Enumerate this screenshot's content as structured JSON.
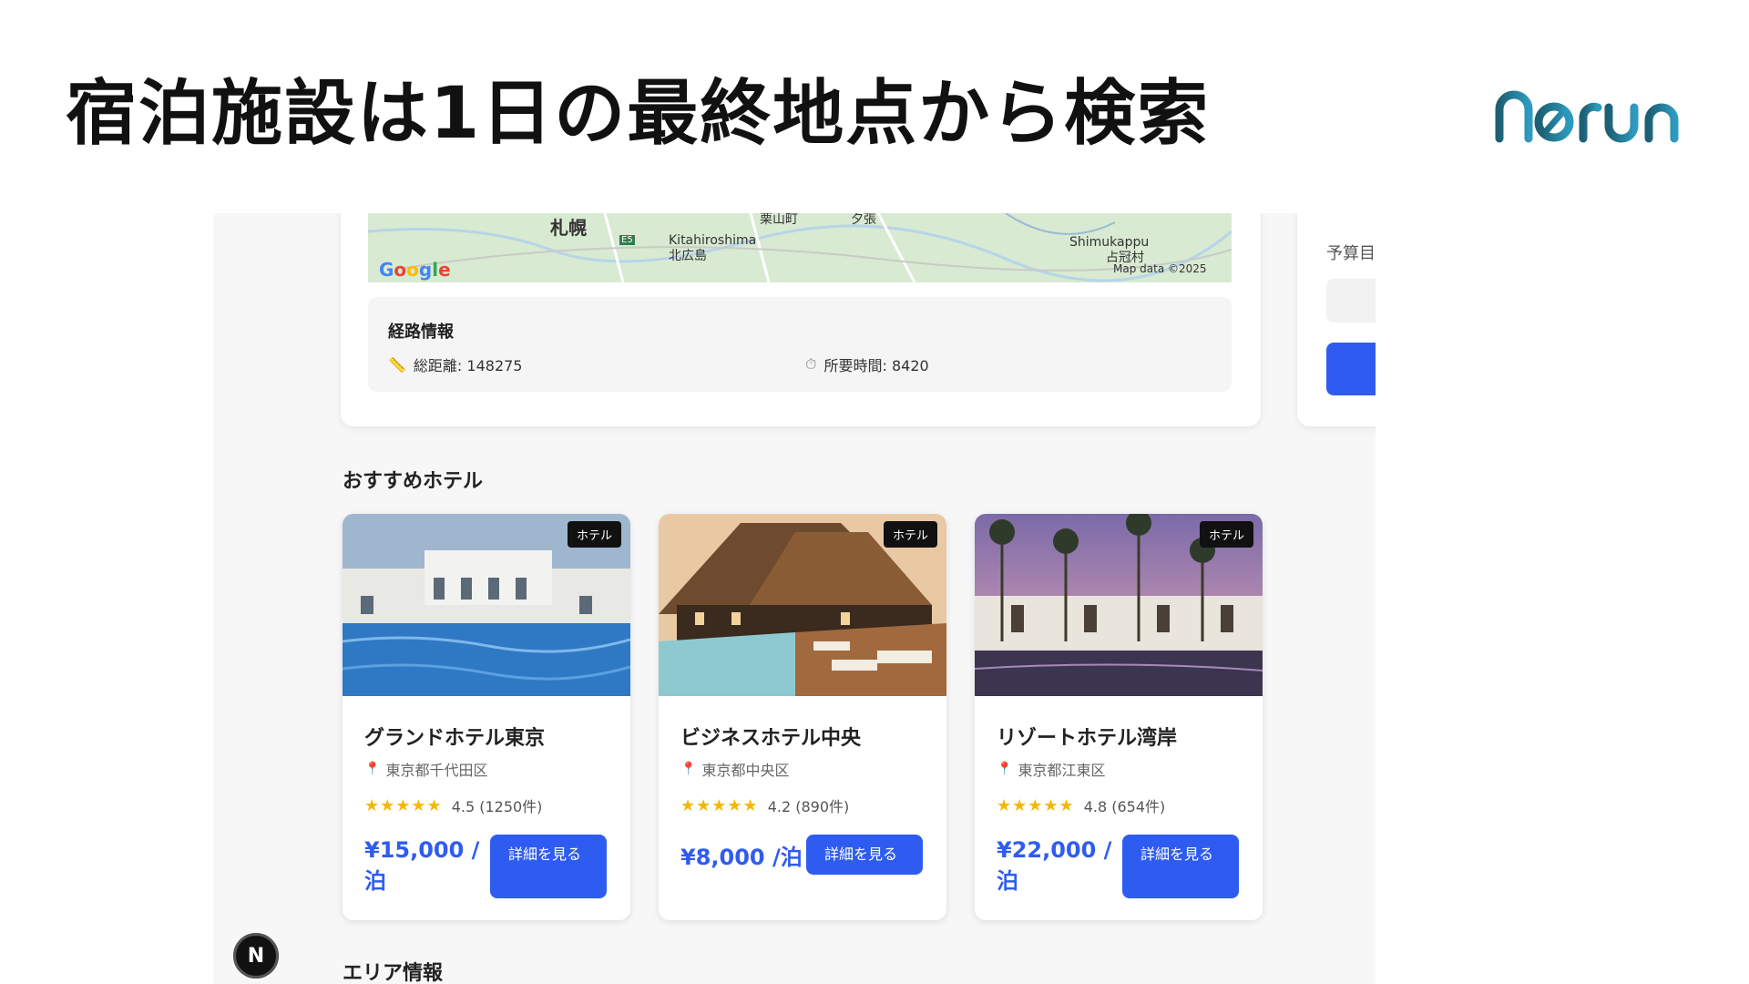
{
  "slide": {
    "title": "宿泊施設は1日の最終地点から検索",
    "logo_text": "norun"
  },
  "map": {
    "labels": [
      "札幌",
      "Kitahiroshima",
      "北広島",
      "Shimukappu",
      "占冠村",
      "栗山町",
      "夕張",
      "E5"
    ],
    "attribution": "Map data ©2025",
    "google_letters": [
      "G",
      "o",
      "o",
      "g",
      "l",
      "e"
    ]
  },
  "route": {
    "title": "経路情報",
    "distance_label": "総距離: 148275",
    "time_label": "所要時間: 8420",
    "distance_icon": "ruler-icon",
    "time_icon": "stopwatch-icon"
  },
  "side_panel": {
    "label": "予算目"
  },
  "recommended": {
    "title": "おすすめホテル",
    "hotels": [
      {
        "badge": "ホテル",
        "name": "グランドホテル東京",
        "location": "東京都千代田区",
        "stars": "★★★★★",
        "rating": "4.5 (1250件)",
        "price": "¥15,000 /泊",
        "button": "詳細を見る"
      },
      {
        "badge": "ホテル",
        "name": "ビジネスホテル中央",
        "location": "東京都中央区",
        "stars": "★★★★★",
        "rating": "4.2 (890件)",
        "price": "¥8,000 /泊",
        "button": "詳細を見る"
      },
      {
        "badge": "ホテル",
        "name": "リゾートホテル湾岸",
        "location": "東京都江東区",
        "stars": "★★★★★",
        "rating": "4.8 (654件)",
        "price": "¥22,000 /泊",
        "button": "詳細を見る"
      }
    ]
  },
  "area": {
    "title": "エリア情報"
  },
  "next_badge": "N",
  "colors": {
    "accent": "#2f5cf0",
    "map_green": "#d8ead1",
    "logo_teal": "#1f6f8b"
  }
}
